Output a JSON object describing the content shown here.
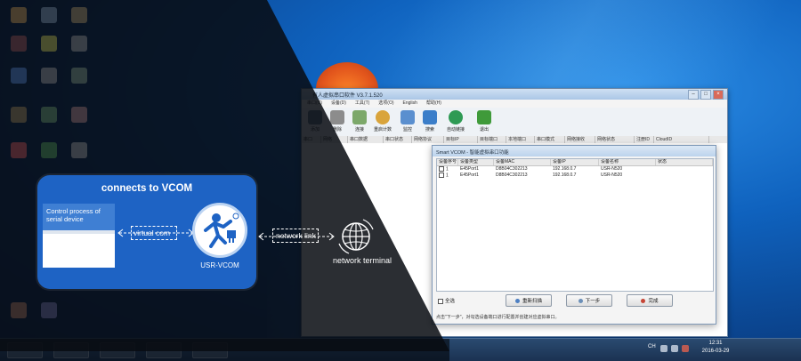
{
  "panel": {
    "title": "connects to VCOM",
    "process_label": "Control process of serial device",
    "virtual_com_label": "virtual com",
    "vcom_label": "USR-VCOM",
    "network_link_label": "network link",
    "network_terminal_label": "network terminal"
  },
  "app": {
    "title": "有人虚拟串口软件 V3.7.1.520",
    "menu": [
      "串口(C)",
      "设备(D)",
      "工具(T)",
      "选项(O)",
      "English",
      "帮助(H)"
    ],
    "toolbar": [
      "添加",
      "删除",
      "连接",
      "重启计数",
      "监控",
      "搜索",
      "自动链接",
      "退出"
    ],
    "columns": [
      "串口",
      "网络",
      "串口数据",
      "串口状态",
      "网络协议",
      "目标IP",
      "目标端口",
      "本地端口",
      "串口模式",
      "网络接收",
      "网络状态",
      "注册ID",
      "CloudID"
    ]
  },
  "dialog": {
    "title": "Smart VCOM - 智能虚拟串口功能",
    "columns": [
      "设备序号",
      "设备类型",
      "设备MAC",
      "设备IP",
      "设备名称",
      "状态"
    ],
    "rows": [
      {
        "index": "1",
        "type": "E45Port1",
        "mac": "D8B04C302213",
        "ip": "192.168.0.7",
        "name": "USR-N520",
        "status": ""
      },
      {
        "index": "1",
        "type": "E45Port1",
        "mac": "D8B04C302213",
        "ip": "192.168.0.7",
        "name": "USR-N520",
        "status": ""
      }
    ],
    "select_all": "全选",
    "search_button": "重新扫描",
    "next_button": "下一步",
    "finish_button": "完成",
    "status_text": "点击\"下一步\"，对勾选设备端口进行配置并创建对应虚拟串口。"
  },
  "taskbar": {
    "time": "12:31",
    "date": "2016-03-29",
    "lang": "CH"
  },
  "colors": {
    "panel": "#1e63c4",
    "desktop": "#0f62be",
    "overlay": "#0b0f16"
  }
}
